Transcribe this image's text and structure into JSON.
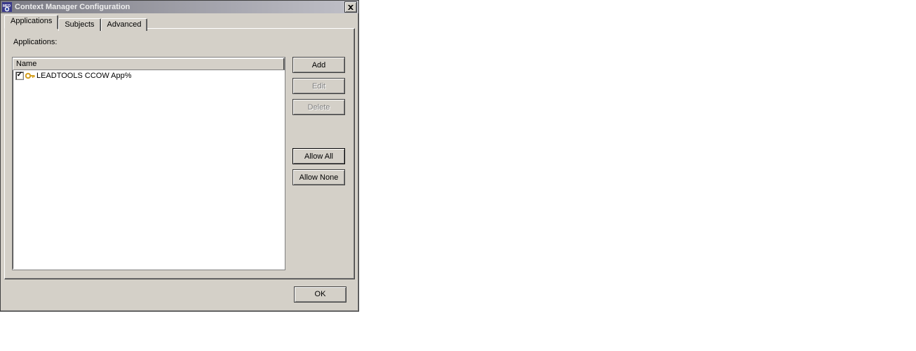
{
  "window": {
    "title": "Context Manager Configuration"
  },
  "tabs": {
    "items": [
      {
        "label": "Applications",
        "active": true
      },
      {
        "label": "Subjects",
        "active": false
      },
      {
        "label": "Advanced",
        "active": false
      }
    ]
  },
  "panel": {
    "list_label": "Applications:",
    "column_header": "Name",
    "rows": [
      {
        "checked": true,
        "name": "LEADTOOLS CCOW App%"
      }
    ]
  },
  "buttons": {
    "add": "Add",
    "edit": "Edit",
    "delete": "Delete",
    "allow_all": "Allow All",
    "allow_none": "Allow None",
    "ok": "OK"
  },
  "icons": {
    "app": "med-plus",
    "row": "key-icon",
    "close": "close-icon"
  }
}
